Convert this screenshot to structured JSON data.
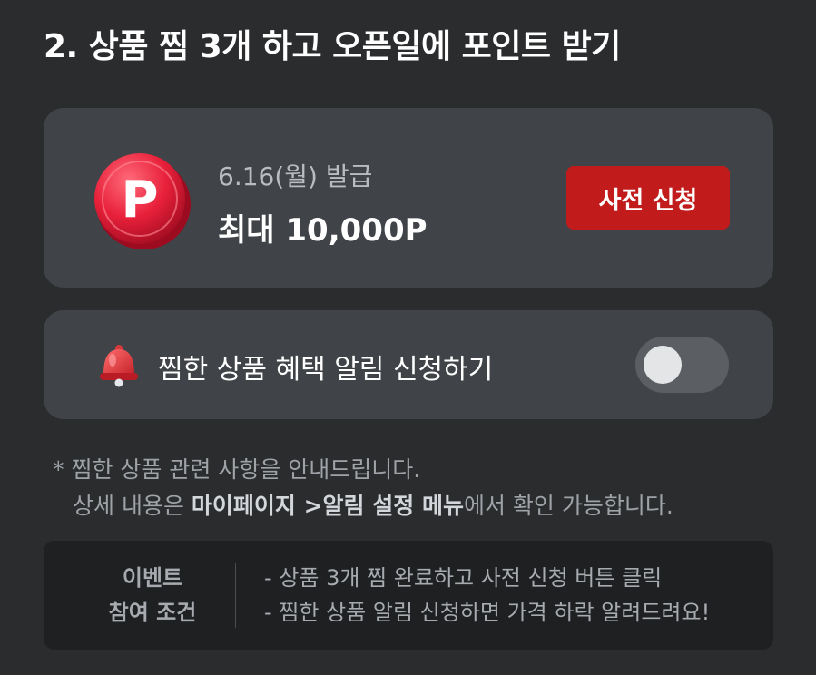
{
  "header": {
    "title": "2. 상품 찜 3개 하고 오픈일에 포인트 받기"
  },
  "point_card": {
    "coin_letter": "P",
    "issue_date": "6.16(월) 발급",
    "max_points": "최대 10,000P",
    "apply_button": "사전 신청",
    "colors": {
      "button": "#c11b1b",
      "coin": "#e8203a"
    }
  },
  "alert_card": {
    "label": "찜한 상품 혜택 알림 신청하기",
    "toggle_on": false
  },
  "notice": {
    "line1": "* 찜한 상품 관련 사항을 안내드립니다.",
    "line2_prefix": "상세 내용은 ",
    "line2_highlight": "마이페이지 >알림 설정 메뉴",
    "line2_suffix": "에서 확인 가능합니다."
  },
  "conditions": {
    "head_line1": "이벤트",
    "head_line2": "참여 조건",
    "items": [
      "- 상품 3개 찜 완료하고 사전 신청 버튼 클릭",
      "- 찜한 상품 알림 신청하면 가격 하락 알려드려요!"
    ]
  }
}
